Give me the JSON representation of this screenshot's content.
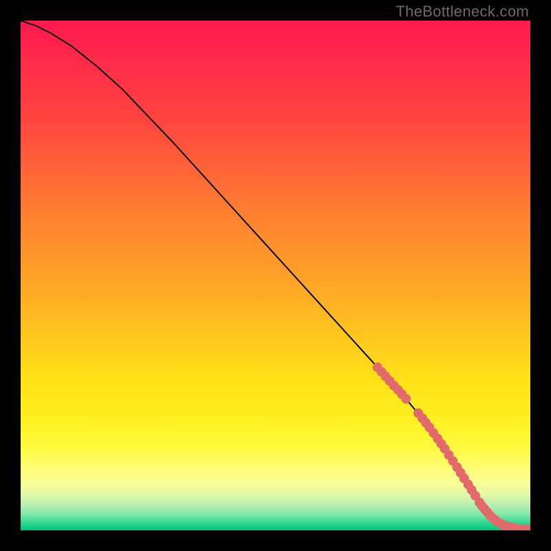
{
  "watermark": "TheBottleneck.com",
  "chart_data": {
    "type": "line",
    "title": "",
    "xlabel": "",
    "ylabel": "",
    "xlim": [
      0,
      100
    ],
    "ylim": [
      0,
      100
    ],
    "grid": false,
    "series": [
      {
        "name": "curve",
        "x": [
          0,
          3,
          6,
          10,
          15,
          20,
          30,
          40,
          50,
          60,
          70,
          75,
          80,
          82,
          84,
          86,
          88,
          90,
          92,
          94,
          96,
          98,
          100
        ],
        "y": [
          100,
          99,
          97.5,
          95,
          91,
          86.5,
          76,
          65,
          54,
          43,
          32,
          26.5,
          20.5,
          17.7,
          14.8,
          11.8,
          8.7,
          5.5,
          3.0,
          1.4,
          0.6,
          0.3,
          0.2
        ]
      }
    ],
    "markers": [
      {
        "x": 70.0,
        "y": 32.0
      },
      {
        "x": 70.8,
        "y": 31.1
      },
      {
        "x": 71.6,
        "y": 30.2
      },
      {
        "x": 72.4,
        "y": 29.3
      },
      {
        "x": 73.2,
        "y": 28.4
      },
      {
        "x": 74.0,
        "y": 27.6
      },
      {
        "x": 74.8,
        "y": 26.7
      },
      {
        "x": 75.6,
        "y": 25.8
      },
      {
        "x": 78.0,
        "y": 23.0
      },
      {
        "x": 78.8,
        "y": 22.0
      },
      {
        "x": 79.5,
        "y": 21.1
      },
      {
        "x": 80.2,
        "y": 20.2
      },
      {
        "x": 81.0,
        "y": 19.1
      },
      {
        "x": 81.8,
        "y": 18.0
      },
      {
        "x": 82.5,
        "y": 17.0
      },
      {
        "x": 83.2,
        "y": 16.0
      },
      {
        "x": 84.0,
        "y": 14.8
      },
      {
        "x": 84.8,
        "y": 13.6
      },
      {
        "x": 85.6,
        "y": 12.4
      },
      {
        "x": 86.3,
        "y": 11.3
      },
      {
        "x": 87.0,
        "y": 10.2
      },
      {
        "x": 87.8,
        "y": 9.0
      },
      {
        "x": 88.5,
        "y": 7.9
      },
      {
        "x": 89.2,
        "y": 6.8
      },
      {
        "x": 90.0,
        "y": 5.5
      },
      {
        "x": 90.5,
        "y": 4.8
      },
      {
        "x": 91.0,
        "y": 4.2
      },
      {
        "x": 91.5,
        "y": 3.6
      },
      {
        "x": 92.0,
        "y": 3.0
      },
      {
        "x": 92.5,
        "y": 2.5
      },
      {
        "x": 93.0,
        "y": 2.1
      },
      {
        "x": 93.5,
        "y": 1.7
      },
      {
        "x": 94.0,
        "y": 1.4
      },
      {
        "x": 94.5,
        "y": 1.1
      },
      {
        "x": 95.0,
        "y": 0.9
      },
      {
        "x": 95.5,
        "y": 0.75
      },
      {
        "x": 96.0,
        "y": 0.6
      },
      {
        "x": 97.0,
        "y": 0.45
      },
      {
        "x": 98.5,
        "y": 0.3
      },
      {
        "x": 99.2,
        "y": 0.25
      },
      {
        "x": 100.0,
        "y": 0.2
      }
    ],
    "marker_color": "#e36a6a",
    "curve_color": "#000000"
  }
}
